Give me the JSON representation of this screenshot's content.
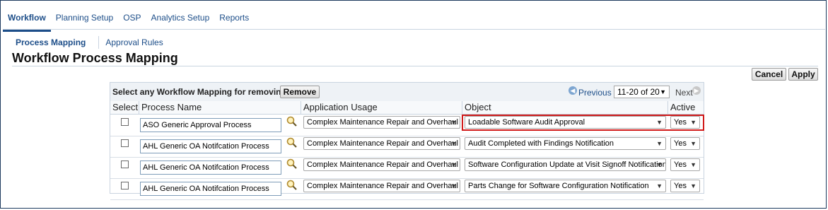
{
  "tabs": [
    "Workflow",
    "Planning Setup",
    "OSP",
    "Analytics Setup",
    "Reports"
  ],
  "subtabs": [
    "Process Mapping",
    "Approval Rules"
  ],
  "page_title": "Workflow Process Mapping",
  "buttons": {
    "cancel": "Cancel",
    "apply": "Apply",
    "remove": "Remove"
  },
  "table": {
    "toolbar_label": "Select any Workflow Mapping for removing",
    "pagination": {
      "previous": "Previous",
      "range": "11-20 of 20",
      "next": "Next"
    },
    "headers": {
      "select": "Select",
      "process_name": "Process Name",
      "application_usage": "Application Usage",
      "object": "Object",
      "active": "Active"
    },
    "rows": [
      {
        "process_name": "ASO Generic Approval Process",
        "application_usage": "Complex Maintenance Repair and Overhaul",
        "object": "Loadable Software Audit Approval",
        "active": "Yes",
        "highlighted": true
      },
      {
        "process_name": "AHL Generic OA Notifcation Process",
        "application_usage": "Complex Maintenance Repair and Overhaul",
        "object": "Audit Completed with Findings Notification",
        "active": "Yes"
      },
      {
        "process_name": "AHL Generic OA Notifcation Process",
        "application_usage": "Complex Maintenance Repair and Overhaul",
        "object": "Software Configuration Update at Visit Signoff Notification",
        "active": "Yes"
      },
      {
        "process_name": "AHL Generic OA Notifcation Process",
        "application_usage": "Complex Maintenance Repair and Overhaul",
        "object": "Parts Change for Software Configuration Notification",
        "active": "Yes"
      }
    ]
  },
  "colors": {
    "link": "#1d4e89",
    "highlight": "#d11a1a"
  },
  "icons": {
    "search": "search-icon",
    "previous": "previous-arrow-icon",
    "next": "next-arrow-icon"
  }
}
